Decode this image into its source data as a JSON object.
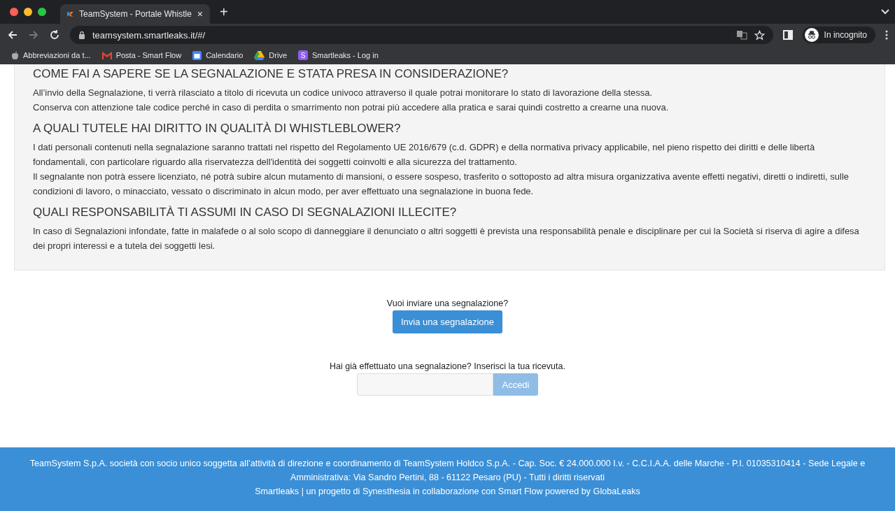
{
  "browser": {
    "tab": {
      "title": "TeamSystem - Portale Whistle",
      "selected": true
    },
    "new_tab": "+",
    "close": "×",
    "url": "teamsystem.smartleaks.it/#/",
    "back_disabled": false,
    "forward_disabled": true,
    "profile": "In incognito",
    "bookmarks": [
      {
        "kind": "apple",
        "label": "Abbreviazioni da t..."
      },
      {
        "kind": "gmail",
        "label": "Posta - Smart Flow"
      },
      {
        "kind": "calendar",
        "label": "Calendario"
      },
      {
        "kind": "drive",
        "label": "Drive"
      },
      {
        "kind": "letter",
        "letter": "S",
        "label": "Smartleaks - Log in"
      }
    ]
  },
  "info": {
    "sections": [
      {
        "heading": "COME FAI A SAPERE SE LA SEGNALAZIONE E STATA PRESA IN CONSIDERAZIONE?",
        "paragraphs": [
          "All’invio della Segnalazione, ti verrà rilasciato a titolo di ricevuta un codice univoco attraverso il quale potrai monitorare lo stato di lavorazione della stessa.",
          "Conserva con attenzione tale codice perché in caso di perdita o smarrimento non potrai più accedere alla pratica e sarai quindi costretto a crearne una nuova."
        ]
      },
      {
        "heading": "A QUALI TUTELE HAI DIRITTO IN QUALITÀ DI WHISTLEBLOWER?",
        "paragraphs": [
          "I dati personali contenuti nella segnalazione saranno trattati nel rispetto del Regolamento UE 2016/679 (c.d. GDPR) e della normativa privacy applicabile, nel pieno rispetto dei diritti e delle libertà fondamentali, con particolare riguardo alla riservatezza dell'identità dei soggetti coinvolti e alla sicurezza del trattamento.",
          "Il segnalante non potrà essere licenziato, né potrà subire alcun mutamento di mansioni, o essere sospeso, trasferito o sottoposto ad altra misura organizzativa avente effetti negativi, diretti o indiretti, sulle condizioni di lavoro, o minacciato, vessato o discriminato in alcun modo, per aver effettuato una segnalazione in buona fede."
        ]
      },
      {
        "heading": "QUALI RESPONSABILITÀ TI ASSUMI IN CASO DI SEGNALAZIONI ILLECITE?",
        "paragraphs": [
          "In caso di Segnalazioni infondate, fatte in malafede o al solo scopo di danneggiare il denunciato o altri soggetti è prevista una responsabilità penale e disciplinare per cui la Società si riserva di agire a difesa dei propri interessi e a tutela dei soggetti lesi."
        ]
      }
    ]
  },
  "submit": {
    "prompt": "Vuoi inviare una segnalazione?",
    "button": "Invia una segnalazione"
  },
  "receipt": {
    "prompt": "Hai già effettuato una segnalazione? Inserisci la tua ricevuta.",
    "button": "Accedi",
    "button_disabled": true
  },
  "footer": {
    "lines": [
      "TeamSystem S.p.A. società con socio unico soggetta all’attività di direzione e coordinamento di TeamSystem Holdco S.p.A. - Cap. Soc. € 24.000.000 I.v. - C.C.I.A.A. delle Marche - P.I. 01035310414 - Sede Legale e Amministrativa: Via Sandro Pertini, 88 - 61122 Pesaro (PU) - Tutti i diritti riservati",
      "Smartleaks | un progetto di Synesthesia in collaborazione con Smart Flow powered by GlobaLeaks"
    ]
  }
}
